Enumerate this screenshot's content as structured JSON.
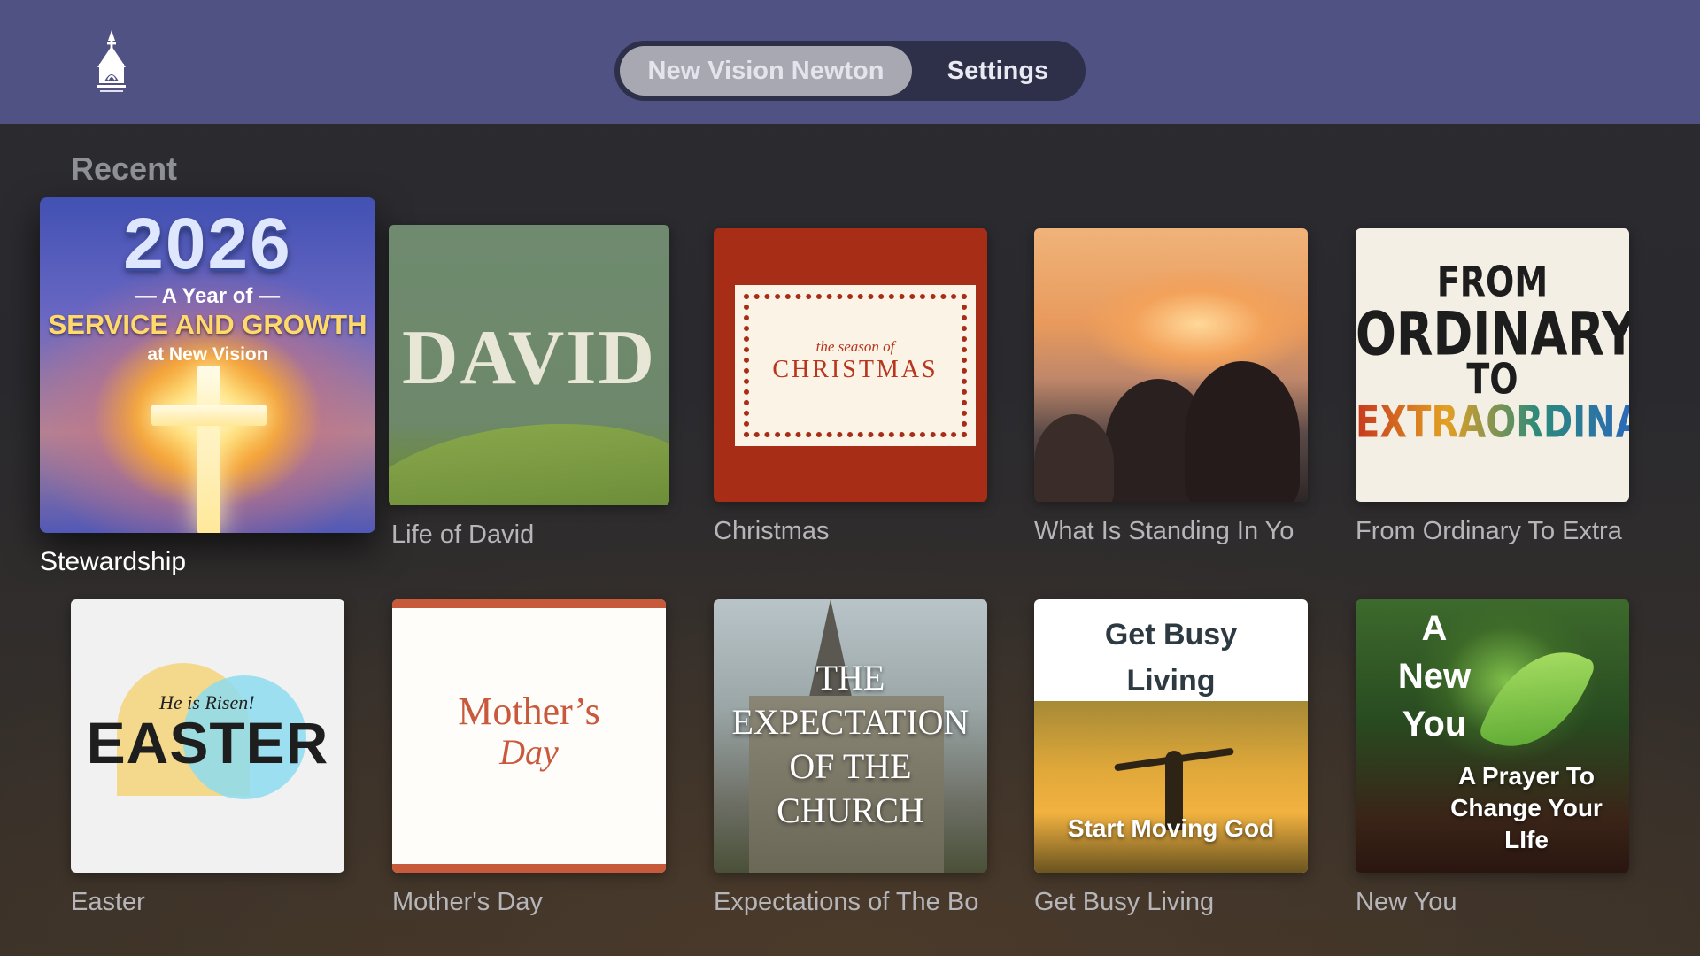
{
  "app": {
    "logo_label": "NEW VISION CHURCH"
  },
  "nav": {
    "tabs": [
      {
        "label": "New Vision Newton",
        "selected": true
      },
      {
        "label": "Settings",
        "selected": false
      }
    ]
  },
  "section": {
    "title": "Recent",
    "items": [
      {
        "caption": "Stewardship",
        "focused": true,
        "art": {
          "year": "2026",
          "line1": "— A Year of —",
          "line2": "SERVICE AND GROWTH",
          "line3": "at New Vision"
        }
      },
      {
        "caption": "Life of David",
        "art": {
          "word": "DAVID"
        }
      },
      {
        "caption": "Christmas",
        "art": {
          "small": "the season of",
          "big": "CHRISTMAS"
        }
      },
      {
        "caption": "What Is Standing In Yo"
      },
      {
        "caption": "From Ordinary To Extra",
        "art": {
          "l1": "FROM",
          "l2": "ORDINARY",
          "l3": "TO",
          "l4": "EXTRAORDINARY"
        }
      },
      {
        "caption": "Easter",
        "art": {
          "small": "He is Risen!",
          "word": "EASTER"
        }
      },
      {
        "caption": "Mother's Day",
        "art": {
          "l1": "Mother’s",
          "l2": "Day"
        }
      },
      {
        "caption": "Expectations of The Bo",
        "art": {
          "text": "THE EXPECTATION OF THE CHURCH"
        }
      },
      {
        "caption": "Get Busy Living",
        "art": {
          "top1": "Get Busy",
          "top2": "Living",
          "caption": "Start Moving God"
        }
      },
      {
        "caption": "New You",
        "art": {
          "l1": "A",
          "l2": "New",
          "l3": "You",
          "sub": "A Prayer To Change Your LIfe"
        }
      }
    ]
  },
  "colors": {
    "header_bg": "#4f5282",
    "segment_bg": "#2e2f48",
    "segment_active": "#a8a8b2",
    "christmas_red": "#a82d16",
    "mothers_orange": "#c65a3a"
  }
}
